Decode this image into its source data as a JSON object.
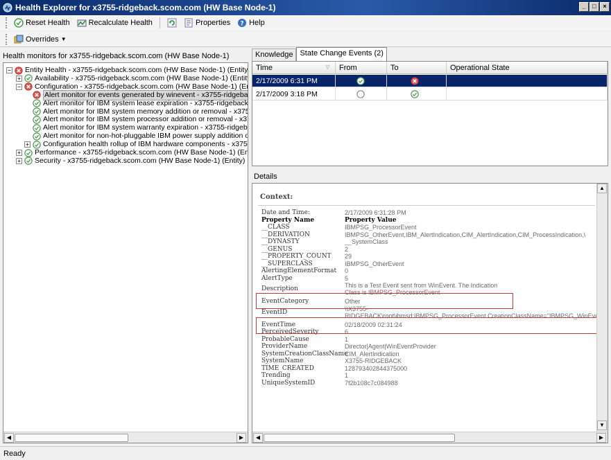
{
  "window": {
    "title": "Health Explorer for x3755-ridgeback.scom.com (HW Base Node-1)"
  },
  "toolbar": {
    "reset_health": "Reset Health",
    "recalculate_health": "Recalculate Health",
    "properties": "Properties",
    "help": "Help",
    "overrides": "Overrides"
  },
  "left": {
    "header": "Health monitors for x3755-ridgeback.scom.com (HW Base Node-1)",
    "tree": [
      {
        "label": "Entity Health - x3755-ridgeback.scom.com (HW Base Node-1) (Entity)",
        "status": "error",
        "expander": "−"
      },
      {
        "label": "Availability - x3755-ridgeback.scom.com (HW Base Node-1) (Entity)",
        "status": "ok",
        "expander": "+"
      },
      {
        "label": "Configuration - x3755-ridgeback.scom.com (HW Base Node-1) (Entity)",
        "status": "error",
        "expander": "−"
      },
      {
        "label": "Alert monitor for events generated by winevent - x3755-ridgeback.",
        "status": "error",
        "expander": ""
      },
      {
        "label": "Alert monitor for IBM system lease expiration - x3755-ridgeback.scc",
        "status": "ok",
        "expander": ""
      },
      {
        "label": "Alert monitor for IBM system memory addition or removal - x3755-ric",
        "status": "ok",
        "expander": ""
      },
      {
        "label": "Alert monitor for IBM system processor addition or removal - x3755-",
        "status": "ok",
        "expander": ""
      },
      {
        "label": "Alert monitor for IBM system warranty expiration - x3755-ridgeback.",
        "status": "ok",
        "expander": ""
      },
      {
        "label": "Alert monitor for non-hot-pluggable IBM power supply addition or re",
        "status": "ok",
        "expander": ""
      },
      {
        "label": "Configuration health rollup of IBM hardware components - x3755-ri",
        "status": "ok",
        "expander": "+"
      },
      {
        "label": "Performance - x3755-ridgeback.scom.com (HW Base Node-1) (Entity)",
        "status": "ok",
        "expander": "+"
      },
      {
        "label": "Security - x3755-ridgeback.scom.com (HW Base Node-1) (Entity)",
        "status": "ok",
        "expander": "+"
      }
    ]
  },
  "tabs": {
    "knowledge": "Knowledge",
    "state_change": "State Change Events (2)"
  },
  "events": {
    "columns": {
      "time": "Time",
      "from": "From",
      "to": "To",
      "state": "Operational State"
    },
    "rows": [
      {
        "time": "2/17/2009 6:31 PM",
        "from": "ok",
        "to": "error",
        "state": ""
      },
      {
        "time": "2/17/2009 3:18 PM",
        "from": "empty",
        "to": "ok",
        "state": ""
      }
    ]
  },
  "details": {
    "label": "Details",
    "context_title": "Context:",
    "properties": [
      {
        "name": "Date and Time:",
        "value": "2/17/2009 6:31:28 PM"
      },
      {
        "name": "Property Name",
        "value": "Property Value",
        "bold": true
      },
      {
        "name": "__CLASS",
        "value": "IBMPSG_ProcessorEvent"
      },
      {
        "name": "__DERIVATION",
        "value": "IBMPSG_OtherEvent,IBM_AlertIndication,CIM_AlertIndication,CIM_ProcessIndication,\\"
      },
      {
        "name": "__DYNASTY",
        "value": "__SystemClass"
      },
      {
        "name": "__GENUS",
        "value": "2"
      },
      {
        "name": "__PROPERTY_COUNT",
        "value": "29"
      },
      {
        "name": "__SUPERCLASS",
        "value": "IBMPSG_OtherEvent"
      },
      {
        "name": "AlertingElementFormat",
        "value": "0"
      },
      {
        "name": "AlertType",
        "value": "5"
      },
      {
        "name": "Description",
        "value": "This is a Test Event sent from WinEvent. The Indication",
        "value2": "Class is IBMPSG_ProcessorEvent"
      },
      {
        "name": "EventCategory",
        "value": "Other"
      },
      {
        "name": "EventID",
        "value": "\\\\X3755-",
        "value2": "RIDGEBACK\\root\\ibmsd:IBMPSG_ProcessorEvent.CreationClassName=\"IBMPSG_WinEve"
      },
      {
        "name": "EventTime",
        "value": "02/18/2009 02:31:24"
      },
      {
        "name": "PerceivedSeverity",
        "value": "6"
      },
      {
        "name": "ProbableCause",
        "value": "1"
      },
      {
        "name": "ProviderName",
        "value": "Director|Agent|WinEventProvider"
      },
      {
        "name": "SystemCreationClassName",
        "value": "CIM_AlertIndication"
      },
      {
        "name": "SystemName",
        "value": "X3755-RIDGEBACK"
      },
      {
        "name": "TIME_CREATED",
        "value": "128793402844375000"
      },
      {
        "name": "Trending",
        "value": "1"
      },
      {
        "name": "UniqueSystemID",
        "value": "7f2b108c7c084988"
      }
    ]
  },
  "status": {
    "text": "Ready"
  },
  "colors": {
    "highlight_box": "#c63a3a",
    "selection": "#0a246a",
    "error": "#d9534f",
    "ok": "#5aa05a"
  }
}
